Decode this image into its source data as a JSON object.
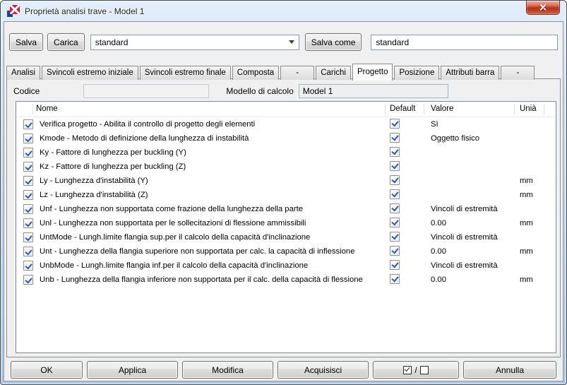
{
  "window": {
    "title": "Proprietà analisi trave - Model 1"
  },
  "icons": {
    "app_icon": "tekla-logo",
    "close_icon": "✕",
    "dropdown_arrow_icon": "▼",
    "checkbox_check_icon": "✓"
  },
  "colors": {
    "titlebar_glass": "#bfd5ea",
    "close_button_red": "#c03a22",
    "content_bg": "#f0f0f0",
    "table_bg": "#ffffff",
    "check_blue": "#3558a8",
    "app_icon_red": "#d81b47",
    "app_icon_blue": "#27408b"
  },
  "toolbar": {
    "save_label": "Salva",
    "load_label": "Carica",
    "profile_value": "standard",
    "save_as_label": "Salva come",
    "save_as_value": "standard"
  },
  "tabs": [
    {
      "label": "Analisi",
      "active": false
    },
    {
      "label": "Svincoli estremo iniziale",
      "active": false
    },
    {
      "label": "Svincoli estremo finale",
      "active": false
    },
    {
      "label": "Composta",
      "active": false
    },
    {
      "label": "-",
      "active": false
    },
    {
      "label": "Carichi",
      "active": false
    },
    {
      "label": "Progetto",
      "active": true
    },
    {
      "label": "Posizione",
      "active": false
    },
    {
      "label": "Attributi barra",
      "active": false
    },
    {
      "label": "-",
      "active": false
    }
  ],
  "fields": {
    "code_label": "Codice",
    "code_value": "",
    "model_label": "Modello di calcolo",
    "model_value": "Model 1"
  },
  "table": {
    "columns": [
      "Nome",
      "Default",
      "Valore",
      "Unià"
    ],
    "rows": [
      {
        "checked": true,
        "name": "Verifica progetto - Abilita il controllo di progetto degli elementi",
        "default_checked": true,
        "value": "Sì",
        "unit": ""
      },
      {
        "checked": true,
        "name": "Kmode - Metodo di definizione della lunghezza di instabilità",
        "default_checked": true,
        "value": "Oggetto fisico",
        "unit": ""
      },
      {
        "checked": true,
        "name": "Ky - Fattore di lunghezza per buckling (Y)",
        "default_checked": true,
        "value": "",
        "unit": ""
      },
      {
        "checked": true,
        "name": "Kz - Fattore di lunghezza per buckling (Z)",
        "default_checked": true,
        "value": "",
        "unit": ""
      },
      {
        "checked": true,
        "name": "Ly - Lunghezza d'instabilità (Y)",
        "default_checked": true,
        "value": "",
        "unit": "mm"
      },
      {
        "checked": true,
        "name": "Lz - Lunghezza d'instabilità (Z)",
        "default_checked": true,
        "value": "",
        "unit": "mm"
      },
      {
        "checked": true,
        "name": "Unf - Lunghezza non supportata come frazione della lunghezza della parte",
        "default_checked": true,
        "value": "Vincoli di estremità",
        "unit": ""
      },
      {
        "checked": true,
        "name": "Unl - Lunghezza non supportata per le sollecitazioni di flessione ammissibili",
        "default_checked": true,
        "value": "0.00",
        "unit": "mm"
      },
      {
        "checked": true,
        "name": "UntMode - Lungh.limite flangia sup.per il calcolo della capacità d'inclinazione",
        "default_checked": true,
        "value": "Vincoli di estremità",
        "unit": ""
      },
      {
        "checked": true,
        "name": "Unt - Lunghezza della flangia superiore non supportata per calc. la capacità di inflessione",
        "default_checked": true,
        "value": "0.00",
        "unit": "mm"
      },
      {
        "checked": true,
        "name": "UnbMode - Lungh.limite flangia inf.per il calcolo della capacità d'inclinazione",
        "default_checked": true,
        "value": "Vincoli di estremità",
        "unit": ""
      },
      {
        "checked": true,
        "name": "Unb - Lunghezza della flangia inferiore non supportata per il calc. della capacità di flessione",
        "default_checked": true,
        "value": "0.00",
        "unit": "mm"
      }
    ]
  },
  "footer": {
    "ok_label": "OK",
    "apply_label": "Applica",
    "modify_label": "Modifica",
    "get_label": "Acquisisci",
    "toggle_separator": "/",
    "cancel_label": "Annulla"
  }
}
